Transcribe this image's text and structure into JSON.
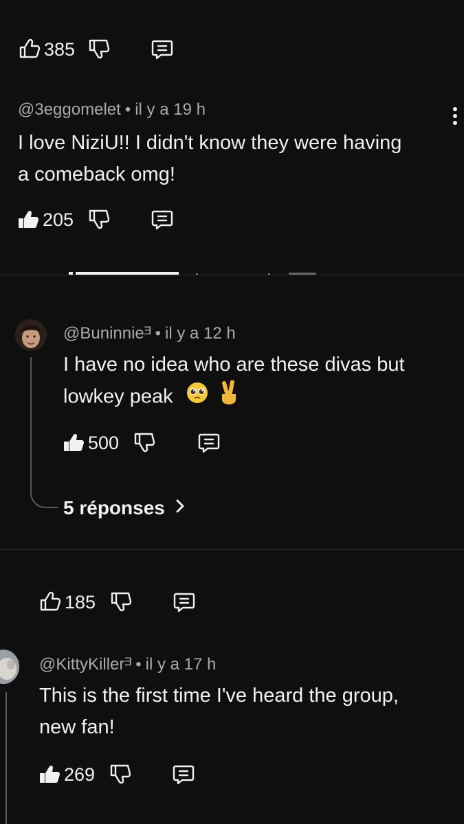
{
  "comments": [
    {
      "like_count": "385"
    },
    {
      "handle": "@3eggomelet",
      "time": "il y a 19 h",
      "text_line1": "I love NiziU!! I didn't know they were having",
      "text_line2": "a comeback omg!",
      "like_count": "205"
    },
    {
      "handle": "@Buninnieᴲ",
      "time": "il y a 12 h",
      "text_line1": "I have no idea who are these divas but",
      "text_line2": "lowkey peak",
      "like_count": "500",
      "replies_label": "5 réponses"
    },
    {
      "like_count": "185"
    },
    {
      "handle": "@KittyKillerᴲ",
      "time": "il y a 17 h",
      "text_line1": "This is the first time I've heard the group,",
      "text_line2": "new fan!",
      "like_count": "269"
    }
  ],
  "icons": {
    "like": "thumbs-up-icon",
    "liked": "thumbs-up-filled-icon",
    "dislike": "thumbs-down-icon",
    "reply": "comment-icon",
    "menu": "more-vert-icon"
  },
  "colors": {
    "background": "#0f0f0f",
    "text": "#f1f1f1",
    "secondary": "#aaaaaa"
  }
}
